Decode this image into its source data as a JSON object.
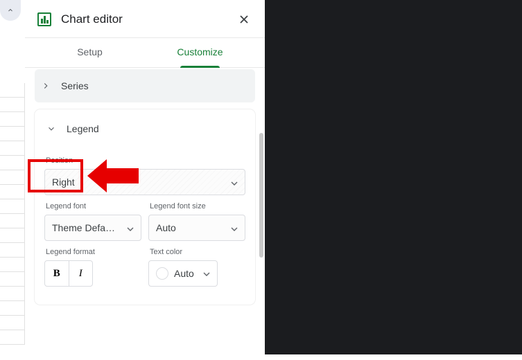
{
  "panel": {
    "title": "Chart editor",
    "tabs": {
      "setup": "Setup",
      "customize": "Customize"
    },
    "sections": {
      "series": "Series",
      "legend": {
        "title": "Legend",
        "position": {
          "label": "Position",
          "value": "Right"
        },
        "font": {
          "label": "Legend font",
          "value": "Theme Defaul..."
        },
        "fontSize": {
          "label": "Legend font size",
          "value": "Auto"
        },
        "format": {
          "label": "Legend format",
          "bold": "B",
          "italic": "I"
        },
        "textColor": {
          "label": "Text color",
          "value": "Auto"
        }
      }
    }
  }
}
